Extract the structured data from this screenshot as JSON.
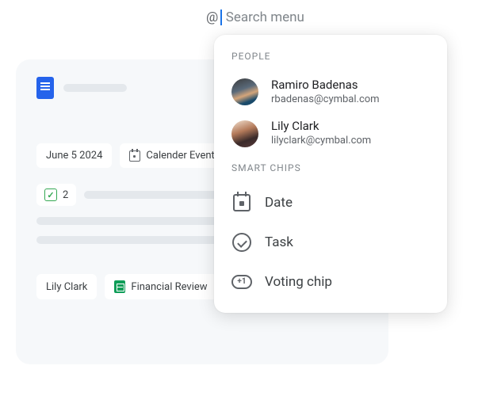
{
  "search": {
    "at": "@",
    "placeholder": "Search menu"
  },
  "doc": {
    "chips": {
      "date": "June 5 2024",
      "event": "Calender Event",
      "vote_count": "2",
      "person": "Lily Clark",
      "file": "Financial Review"
    }
  },
  "popup": {
    "sections": {
      "people": "People",
      "smart_chips": "Smart Chips"
    },
    "people": [
      {
        "name": "Ramiro Badenas",
        "email": "rbadenas@cymbal.com"
      },
      {
        "name": "Lily Clark",
        "email": "lilyclark@cymbal.com"
      }
    ],
    "chips": {
      "date": "Date",
      "task": "Task",
      "voting": "Voting chip",
      "vote_symbol": "+1"
    }
  }
}
